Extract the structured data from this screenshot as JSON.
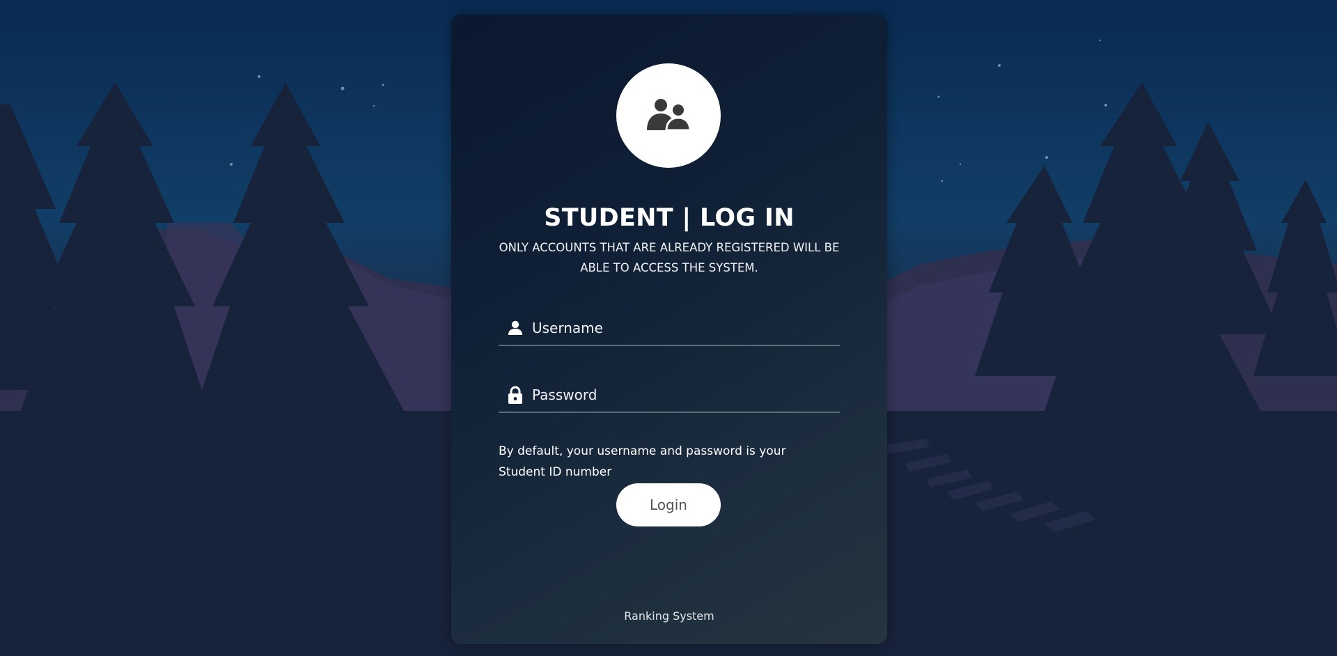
{
  "colors": {
    "sky_top": "#0b2a52",
    "sky_bottom": "#123f66",
    "tree": "#17223b",
    "mountain": "#2f3050",
    "card_accent": "#ffffff",
    "button_text": "#545454"
  },
  "header": {
    "avatar_icon": "users-group-icon",
    "title": "STUDENT | LOG IN",
    "subtitle": "ONLY ACCOUNTS THAT ARE ALREADY REGISTERED WILL BE ABLE TO ACCESS THE SYSTEM."
  },
  "form": {
    "username": {
      "icon": "user-icon",
      "placeholder": "Username",
      "value": ""
    },
    "password": {
      "icon": "lock-icon",
      "placeholder": "Password",
      "value": ""
    },
    "hint": "By default, your username and password is your Student ID number",
    "login_label": "Login"
  },
  "footer": {
    "text": "Ranking System"
  }
}
